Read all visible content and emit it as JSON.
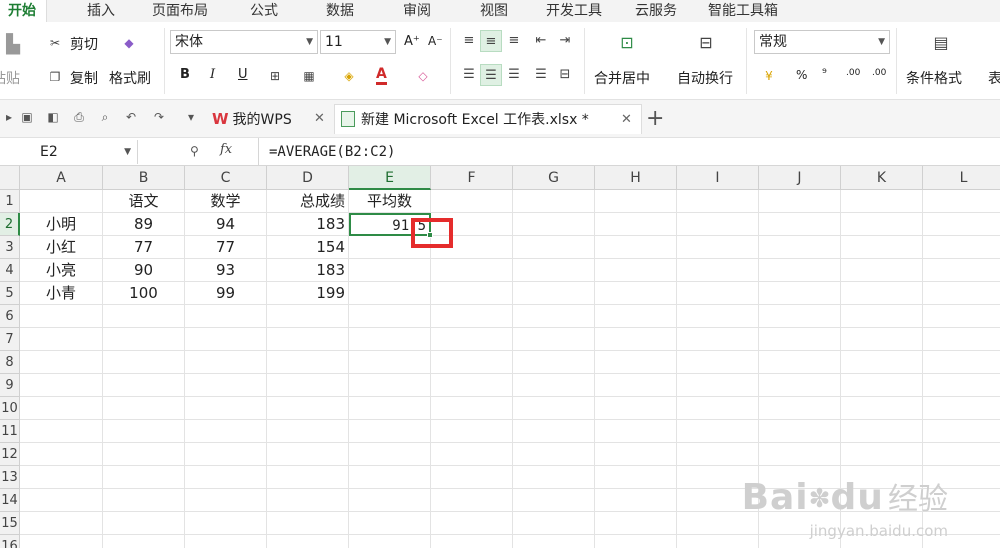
{
  "menu": {
    "tabs": [
      "开始",
      "插入",
      "页面布局",
      "公式",
      "数据",
      "审阅",
      "视图",
      "开发工具",
      "云服务",
      "智能工具箱"
    ],
    "active": "开始"
  },
  "ribbon": {
    "paste": "粘贴",
    "cut": "剪切",
    "copy": "复制",
    "format_painter": "格式刷",
    "font_name": "宋体",
    "font_size": "11",
    "bold": "B",
    "italic": "I",
    "underline": "U",
    "grow_font": "A⁺",
    "shrink_font": "A⁻",
    "font_color_glyph": "A",
    "merge_center": "合并居中",
    "wrap_text": "自动换行",
    "number_format": "常规",
    "percent": "%",
    "comma": "⁹",
    "decimal_inc": ".00",
    "decimal_dec": ".00",
    "conditional_format": "条件格式",
    "table_style_partial": "表"
  },
  "tabbar": {
    "wps_tab": "我的WPS",
    "file_tab": "新建 Microsoft Excel 工作表.xlsx *",
    "new_tab": "+"
  },
  "formula_bar": {
    "name_box": "E2",
    "fx": "fx",
    "formula": "=AVERAGE(B2:C2)"
  },
  "sheet": {
    "columns": [
      "A",
      "B",
      "C",
      "D",
      "E",
      "F",
      "G",
      "H",
      "I",
      "J",
      "K",
      "L"
    ],
    "rows": [
      "1",
      "2",
      "3",
      "4",
      "5",
      "6",
      "7",
      "8",
      "9",
      "10",
      "11",
      "12",
      "13",
      "14",
      "15",
      "16"
    ],
    "selected_cell": "E2",
    "header_row": [
      "",
      "语文",
      "数学",
      "总成绩",
      "平均数"
    ],
    "data": [
      [
        "小明",
        "89",
        "94",
        "183",
        "91.5"
      ],
      [
        "小红",
        "77",
        "77",
        "154",
        ""
      ],
      [
        "小亮",
        "90",
        "93",
        "183",
        ""
      ],
      [
        "小青",
        "100",
        "99",
        "199",
        ""
      ]
    ]
  },
  "watermark": {
    "brand": "Bai",
    "brand2": "du",
    "cn": "经验",
    "url": "jingyan.baidu.com"
  },
  "colors": {
    "accent": "#2e8b46",
    "highlight": "#e52c2c",
    "wps_red": "#d9363e"
  }
}
